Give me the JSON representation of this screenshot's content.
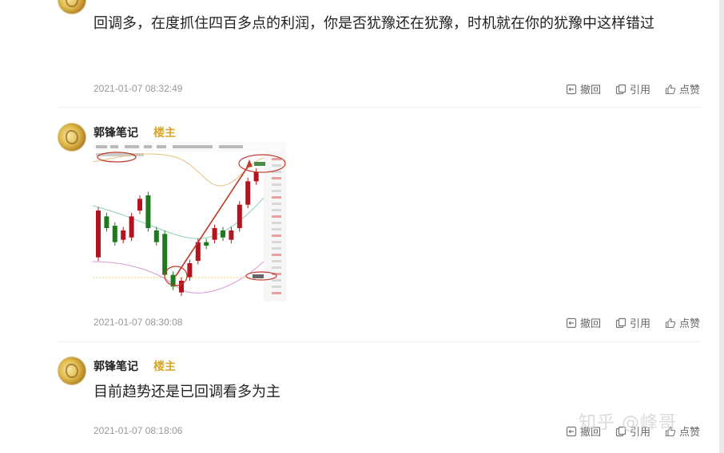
{
  "comments": [
    {
      "text": "回调多，在度抓住四百多点的利润，你是否犹豫还在犹豫，时机就在你的犹豫中这样错过",
      "timestamp": "2021-01-07 08:32:49"
    },
    {
      "author": "郭锋笔记",
      "badge": "楼主",
      "timestamp": "2021-01-07 08:30:08",
      "image_alt": "candlestick chart screenshot"
    },
    {
      "author": "郭锋笔记",
      "badge": "楼主",
      "text": "目前趋势还是已回调看多为主",
      "timestamp": "2021-01-07 08:18:06"
    }
  ],
  "actions": {
    "withdraw_label": "撤回",
    "quote_label": "引用",
    "like_label": "点赞"
  },
  "icons": [
    "withdraw-icon",
    "quote-icon",
    "like-icon"
  ],
  "watermark": "知乎 @峰哥",
  "colors": {
    "badge": "#d8a526",
    "candle_up": "#b4141e",
    "candle_down": "#1e7a1e",
    "annotation": "#c0392b"
  },
  "chart_data": {
    "type": "candlestick",
    "candles": [
      {
        "o": 5,
        "c": 45,
        "color": "red"
      },
      {
        "o": 40,
        "c": 30,
        "color": "green"
      },
      {
        "o": 18,
        "c": 32,
        "color": "green"
      },
      {
        "o": 28,
        "c": 20,
        "color": "red"
      },
      {
        "o": 22,
        "c": 40,
        "color": "red"
      },
      {
        "o": 45,
        "c": 55,
        "color": "red"
      },
      {
        "o": 58,
        "c": 30,
        "color": "green"
      },
      {
        "o": 28,
        "c": 18,
        "color": "green"
      },
      {
        "o": 25,
        "c": -10,
        "color": "green"
      },
      {
        "o": -10,
        "c": -20,
        "color": "green"
      },
      {
        "o": -25,
        "c": -15,
        "color": "red"
      },
      {
        "o": -12,
        "c": 0,
        "color": "red"
      },
      {
        "o": 2,
        "c": 18,
        "color": "red"
      },
      {
        "o": 18,
        "c": 15,
        "color": "green"
      },
      {
        "o": 20,
        "c": 30,
        "color": "red"
      },
      {
        "o": 28,
        "c": 22,
        "color": "green"
      },
      {
        "o": 20,
        "c": 28,
        "color": "red"
      },
      {
        "o": 30,
        "c": 50,
        "color": "red"
      },
      {
        "o": 50,
        "c": 70,
        "color": "red"
      },
      {
        "o": 70,
        "c": 78,
        "color": "red"
      }
    ],
    "ylim": [
      -30,
      90
    ]
  }
}
